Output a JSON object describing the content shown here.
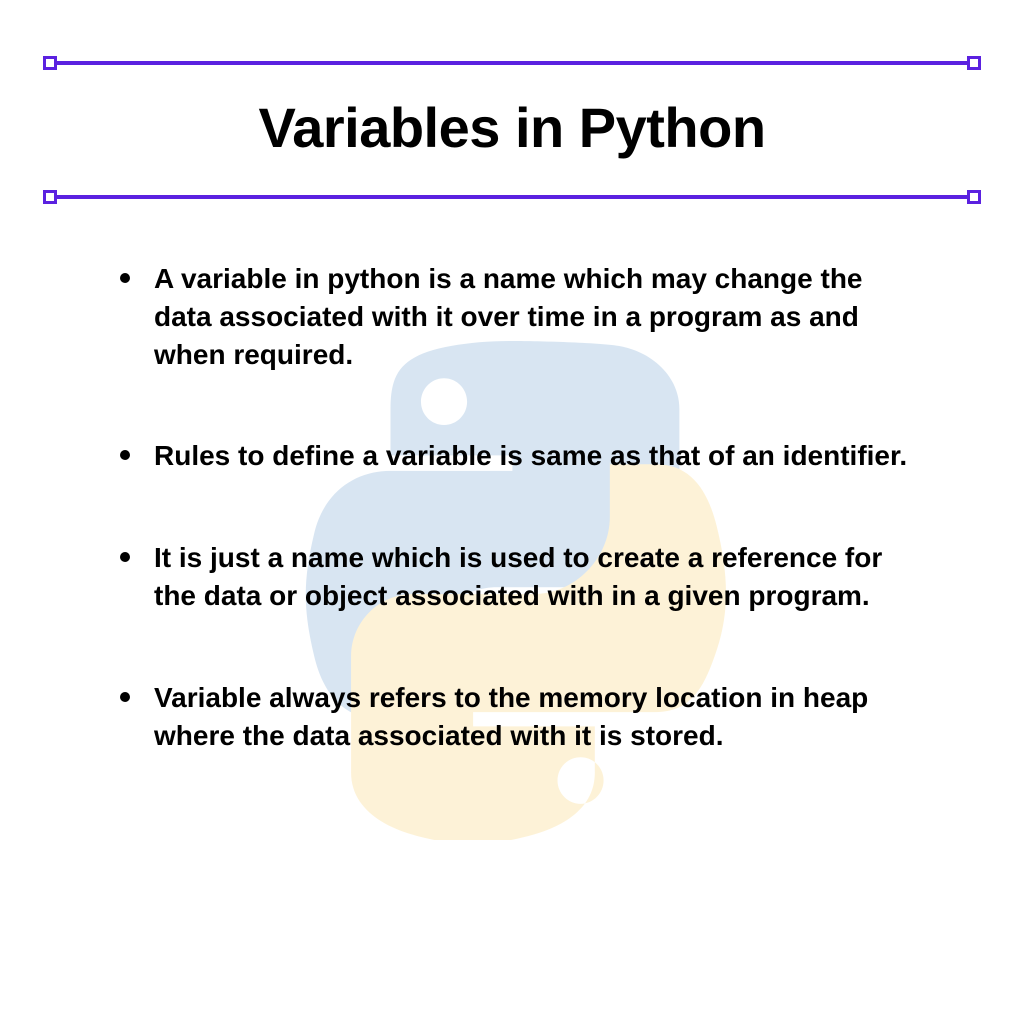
{
  "title": "Variables in Python",
  "bullets": [
    "A variable in python is a name which may change the data associated with it over time in a program as and when required.",
    "Rules to define a variable is same as that of an identifier.",
    "It is just a name which is used to create a reference for the data or object associated with in a given program.",
    "Variable always refers to the memory location in heap where the data associated with it is stored."
  ],
  "accent_color": "#5b21e0",
  "logo_blue": "#b9d1e8",
  "logo_yellow": "#fce9b8"
}
